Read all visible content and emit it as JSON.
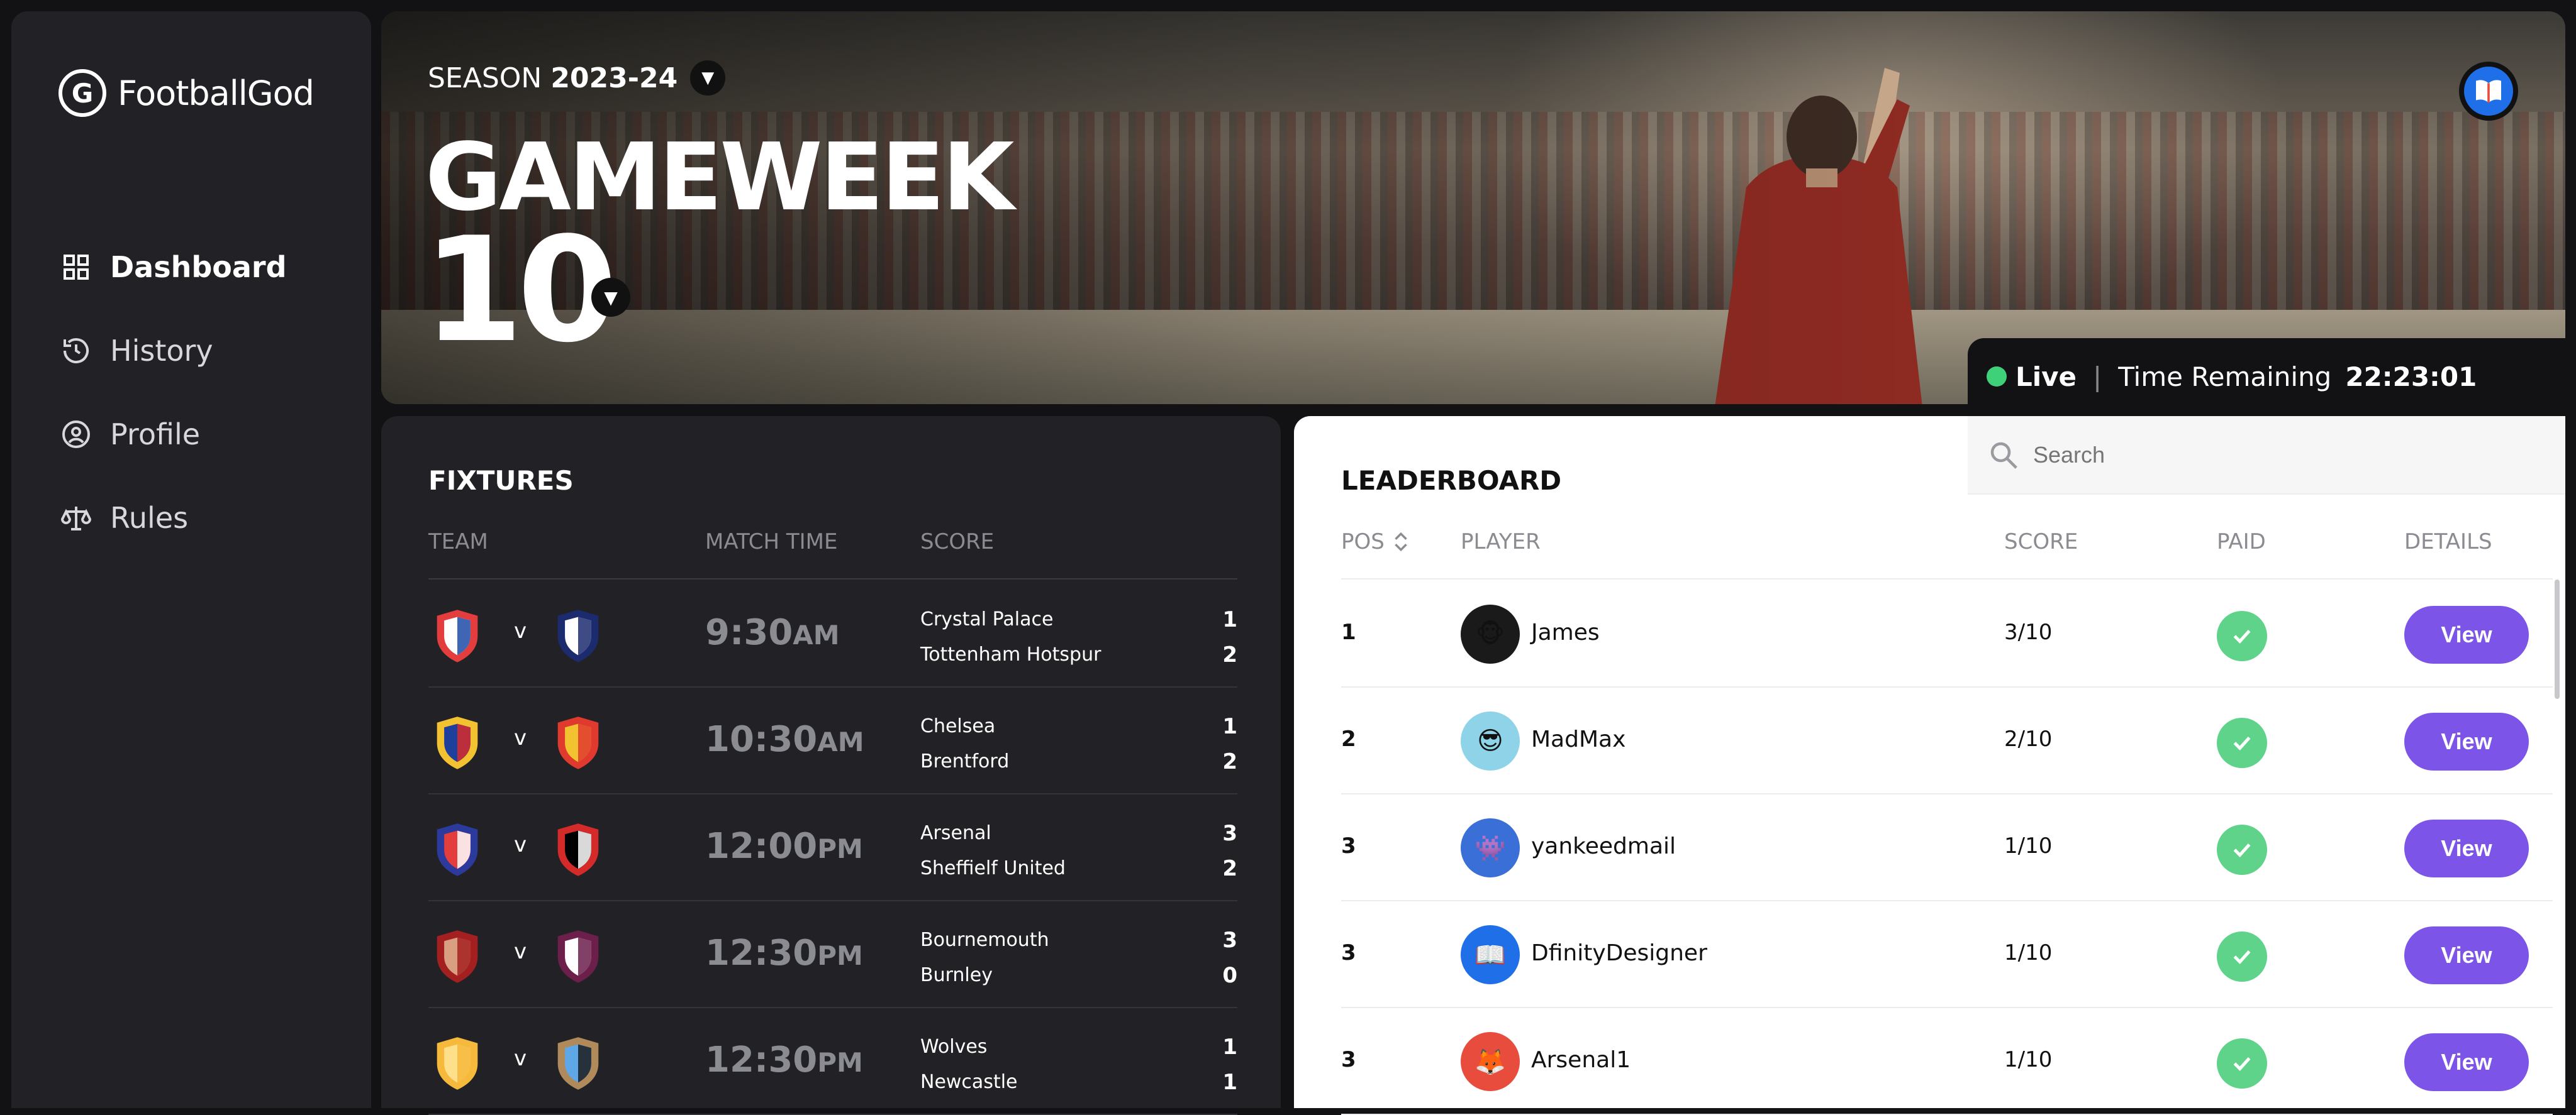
{
  "app": {
    "name": "FootballGod",
    "logo_letter": "G"
  },
  "sidebar": {
    "items": [
      {
        "label": "Dashboard",
        "icon": "grid-icon",
        "active": true
      },
      {
        "label": "History",
        "icon": "history-icon",
        "active": false
      },
      {
        "label": "Profile",
        "icon": "user-circle-icon",
        "active": false
      },
      {
        "label": "Rules",
        "icon": "scales-icon",
        "active": false
      }
    ]
  },
  "hero": {
    "season_label": "SEASON",
    "season_value": "2023-24",
    "gameweek_label": "GAMEWEEK",
    "gameweek_number": "10"
  },
  "status": {
    "live_label": "Live",
    "separator": "|",
    "time_label": "Time Remaining",
    "time_value": "22:23:01",
    "live_color": "#3fd07a"
  },
  "fixtures": {
    "title": "FIXTURES",
    "headers": {
      "team": "TEAM",
      "match_time": "MATCH TIME",
      "score": "SCORE"
    },
    "vs_label": "v",
    "rows": [
      {
        "time": "9:30",
        "ampm": "AM",
        "home": "Crystal Palace",
        "away": "Tottenham Hotspur",
        "home_score": "1",
        "away_score": "2"
      },
      {
        "time": "10:30",
        "ampm": "AM",
        "home": "Chelsea",
        "away": "Brentford",
        "home_score": "1",
        "away_score": "2"
      },
      {
        "time": "12:00",
        "ampm": "PM",
        "home": "Arsenal",
        "away": "Sheffielf United",
        "home_score": "3",
        "away_score": "2"
      },
      {
        "time": "12:30",
        "ampm": "PM",
        "home": "Bournemouth",
        "away": "Burnley",
        "home_score": "3",
        "away_score": "0"
      },
      {
        "time": "12:30",
        "ampm": "PM",
        "home": "Wolves",
        "away": "Newcastle",
        "home_score": "1",
        "away_score": "1"
      }
    ]
  },
  "leaderboard": {
    "title": "LEADERBOARD",
    "search_placeholder": "Search",
    "headers": {
      "pos": "POS",
      "player": "PLAYER",
      "score": "SCORE",
      "paid": "PAID",
      "details": "DETAILS"
    },
    "view_label": "View",
    "rows": [
      {
        "pos": "1",
        "player": "James",
        "score": "3/10"
      },
      {
        "pos": "2",
        "player": "MadMax",
        "score": "2/10"
      },
      {
        "pos": "3",
        "player": "yankeedmail",
        "score": "1/10"
      },
      {
        "pos": "3",
        "player": "DfinityDesigner",
        "score": "1/10"
      },
      {
        "pos": "3",
        "player": "Arsenal1",
        "score": "1/10"
      }
    ],
    "accent_color": "#7c55e8",
    "paid_color": "#5fd38a"
  }
}
